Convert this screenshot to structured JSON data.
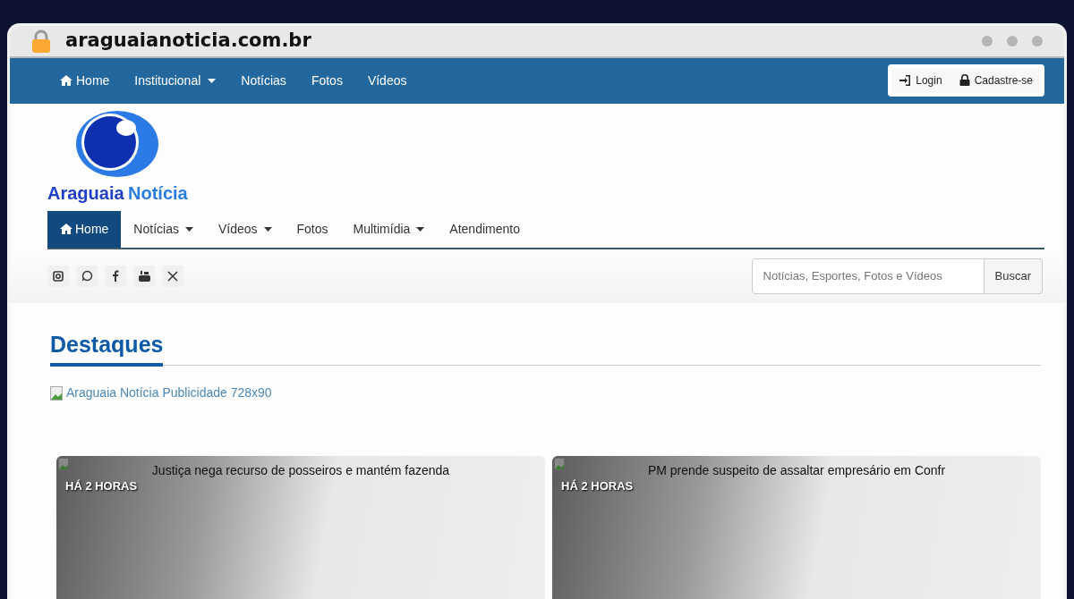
{
  "browser": {
    "url": "araguaianoticia.com.br"
  },
  "top_nav": {
    "items": [
      {
        "label": "Home",
        "dropdown": false
      },
      {
        "label": "Institucional",
        "dropdown": true
      },
      {
        "label": "Notícias",
        "dropdown": false
      },
      {
        "label": "Fotos",
        "dropdown": false
      },
      {
        "label": "Vídeos",
        "dropdown": false
      }
    ],
    "account_buttons": [
      {
        "label": "Login"
      },
      {
        "label": "Cadastre-se"
      }
    ]
  },
  "logo": {
    "word_1": "Araguaia",
    "word_2": "Notícia"
  },
  "main_nav": {
    "items": [
      {
        "label": "Home",
        "dropdown": false,
        "selected": true
      },
      {
        "label": "Notícias",
        "dropdown": true,
        "selected": false
      },
      {
        "label": "Vídeos",
        "dropdown": true,
        "selected": false
      },
      {
        "label": "Fotos",
        "dropdown": false,
        "selected": false
      },
      {
        "label": "Multimídia",
        "dropdown": true,
        "selected": false
      },
      {
        "label": "Atendimento",
        "dropdown": false,
        "selected": false
      }
    ]
  },
  "search": {
    "placeholder": "Notícias, Esportes, Fotos e Vídeos",
    "button": "Buscar"
  },
  "section": {
    "title": "Destaques"
  },
  "ad": {
    "alt_text": "Araguaia Notícia Publicidade 728x90"
  },
  "cards": [
    {
      "time": "HÁ 2 HORAS",
      "title": "Justiça nega recurso de posseiros e mantém fazenda"
    },
    {
      "time": "HÁ 2 HORAS",
      "title": "PM prende suspeito de assaltar empresário em Confr"
    }
  ]
}
